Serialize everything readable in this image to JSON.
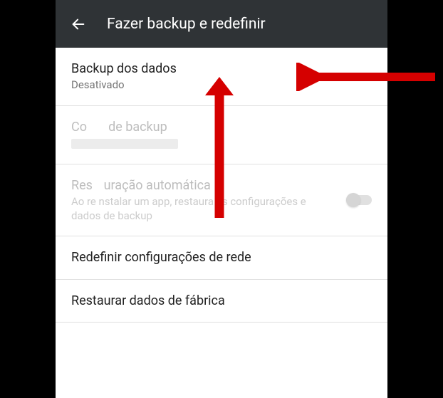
{
  "header": {
    "title": "Fazer backup e redefinir"
  },
  "items": {
    "backup_data": {
      "title": "Backup dos dados",
      "sub": "Desativado"
    },
    "backup_account": {
      "title_prefix": "Co",
      "title_suffix": "de backup"
    },
    "auto_restore": {
      "title_prefix": "Res",
      "title_suffix": "uração automática",
      "sub_prefix": "Ao re",
      "sub_suffix": "nstalar um app, restaura as configurações e dados de backup"
    },
    "reset_network": {
      "title": "Redefinir configurações de rede"
    },
    "factory_reset": {
      "title": "Restaurar dados de fábrica"
    }
  },
  "colors": {
    "arrow": "#d50000"
  }
}
